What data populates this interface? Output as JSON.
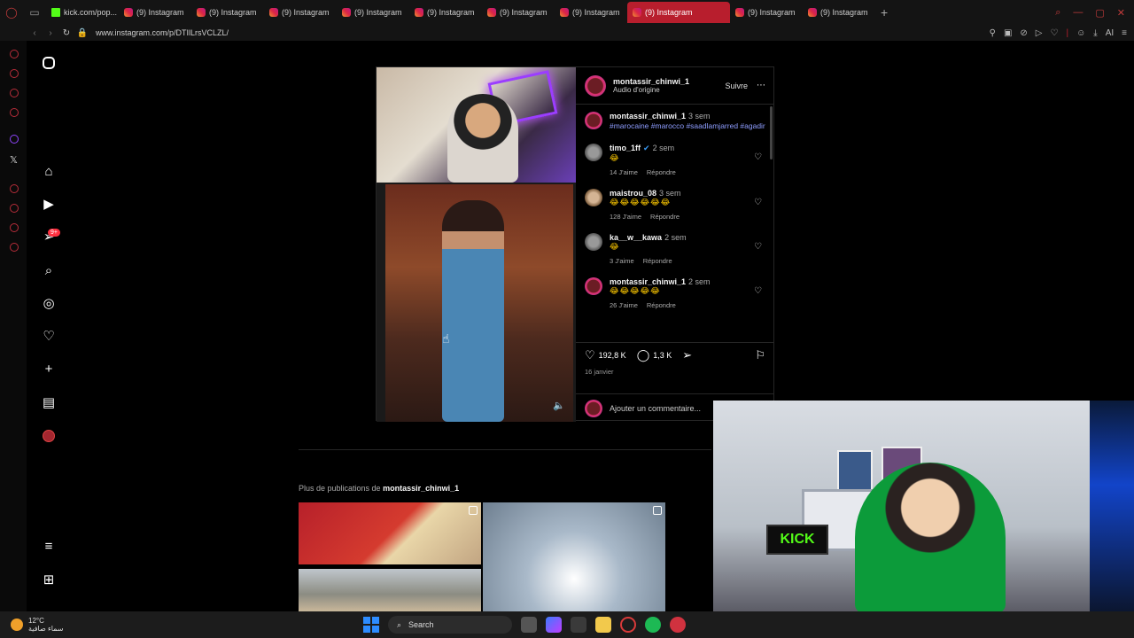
{
  "browser": {
    "tabs": [
      {
        "label": "kick.com/pop...",
        "type": "kick"
      },
      {
        "label": "(9) Instagram",
        "type": "ig"
      },
      {
        "label": "(9) Instagram",
        "type": "ig"
      },
      {
        "label": "(9) Instagram",
        "type": "ig"
      },
      {
        "label": "(9) Instagram",
        "type": "ig"
      },
      {
        "label": "(9) Instagram",
        "type": "ig"
      },
      {
        "label": "(9) Instagram",
        "type": "ig"
      },
      {
        "label": "(9) Instagram",
        "type": "ig"
      },
      {
        "label": "(9) Instagram",
        "type": "ig",
        "active": true
      },
      {
        "label": "(9) Instagram",
        "type": "ig"
      },
      {
        "label": "(9) Instagram",
        "type": "ig"
      }
    ],
    "url": "www.instagram.com/p/DTIlLrsVCLZL/",
    "ai_label": "AI"
  },
  "ig_nav": {
    "notifications_badge": "9+"
  },
  "post": {
    "author": "montassir_chinwi_1",
    "audio": "Audio d'origine",
    "follow_label": "Suivre",
    "more_icon": "⋯",
    "caption": {
      "user": "montassir_chinwi_1",
      "time": "3 sem",
      "hashtags": "#marocaine #marocco #saadlamjarred #agadir"
    },
    "comments": [
      {
        "user": "timo_1ff",
        "verified": true,
        "time": "2 sem",
        "text": "😂",
        "likes": "14 J'aime",
        "reply": "Répondre"
      },
      {
        "user": "maistrou_08",
        "time": "3 sem",
        "text": "😂😂😂😂😂😂",
        "likes": "128 J'aime",
        "reply": "Répondre"
      },
      {
        "user": "ka__w__kawa",
        "time": "2 sem",
        "text": "😂",
        "likes": "3 J'aime",
        "reply": "Répondre"
      },
      {
        "user": "montassir_chinwi_1",
        "time": "2 sem",
        "text": "😂😂😂😂😂",
        "likes": "26 J'aime",
        "reply": "Répondre"
      }
    ],
    "like_count": "192,8 K",
    "comment_count": "1,3 K",
    "date": "16 janvier",
    "add_comment_placeholder": "Ajouter un commentaire..."
  },
  "more_posts": {
    "prefix": "Plus de publications de",
    "user": "montassir_chinwi_1"
  },
  "webcam": {
    "sign": "KICK"
  },
  "taskbar": {
    "temperature": "12°C",
    "weather_text": "سماء صافية",
    "search_label": "Search"
  }
}
